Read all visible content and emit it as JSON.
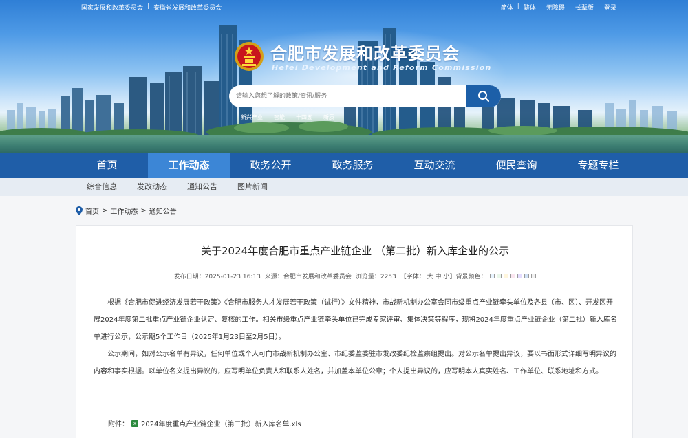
{
  "top_links_left": [
    "国家发展和改革委员会",
    "安徽省发展和改革委员会"
  ],
  "top_links_right": [
    "简体",
    "繁体",
    "无障碍",
    "长辈版",
    "登录"
  ],
  "site": {
    "title_cn": "合肥市发展和改革委员会",
    "title_en": "Hefei Development and Reform Commission"
  },
  "search": {
    "placeholder": "请输入您想了解的政策/资讯/服务",
    "hot_words": [
      "新兴产业",
      "智能",
      "十四五",
      "新质"
    ]
  },
  "main_nav": [
    "首页",
    "工作动态",
    "政务公开",
    "政务服务",
    "互动交流",
    "便民查询",
    "专题专栏"
  ],
  "main_nav_active": "工作动态",
  "sub_nav": [
    "综合信息",
    "发改动态",
    "通知公告",
    "图片新闻"
  ],
  "breadcrumb": [
    "首页",
    "工作动态",
    "通知公告"
  ],
  "article": {
    "title": "关于2024年度合肥市重点产业链企业 （第二批）新入库企业的公示",
    "date_label": "发布日期：",
    "date": "2025-01-23 16:13",
    "source_label": "来源：",
    "source": "合肥市发展和改革委员会",
    "views_label": "浏览量：",
    "views": "2253",
    "font_label": "【字体：",
    "font_sizes": [
      "大",
      "中",
      "小"
    ],
    "bg_label": "】背景颜色：",
    "bg_colors": [
      "#e8f4ff",
      "#e9f7ea",
      "#fff6dc",
      "#fbe6f0",
      "#e4dcff",
      "#cfe0f5",
      "#f2f2f2"
    ],
    "paragraph1": "根据《合肥市促进经济发展若干政策》《合肥市服务人才发展若干政策（试行）》文件精神，市战新机制办公室会同市级重点产业链牵头单位及各县（市、区）、开发区开展2024年度第二批重点产业链企业认定、复核的工作。相关市级重点产业链牵头单位已完成专家评审、集体决策等程序，现将2024年度重点产业链企业（第二批）新入库名单进行公示，公示期5个工作日（2025年1月23日至2月5日）。",
    "paragraph2": "公示期间，如对公示名单有异议，任何单位或个人可向市战新机制办公室、市纪委监委驻市发改委纪检监察组提出。对公示名单提出异议，要以书面形式详细写明异议的内容和事实根据。以单位名义提出异议的，应写明单位负责人和联系人姓名，并加盖本单位公章；个人提出异议的，应写明本人真实姓名、工作单位、联系地址和方式。",
    "attachment_label": "附件：",
    "attachment_name": "2024年度重点产业链企业（第二批）新入库名单.xls"
  }
}
